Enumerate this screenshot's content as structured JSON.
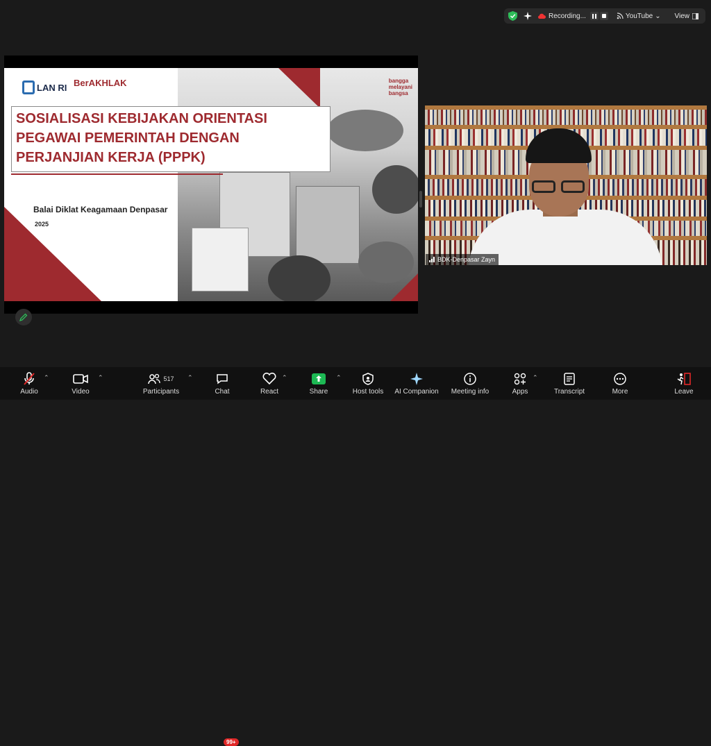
{
  "topbar": {
    "recording_label": "Recording...",
    "stream_label": "YouTube",
    "view_label": "View"
  },
  "slide": {
    "logo_lan": "LAN RI",
    "logo_berakhlak": "BerAKHLAK",
    "logo_bangga": [
      "bangga",
      "melayani",
      "bangsa"
    ],
    "title_lines": [
      "SOSIALISASI KEBIJAKAN ORIENTASI",
      "PEGAWAI PEMERINTAH DENGAN",
      "PERJANJIAN KERJA (PPPK)"
    ],
    "organizer": "Balai Diklat Keagamaan Denpasar",
    "year": "2025"
  },
  "video": {
    "participant_name": "BDK-Denpasar Zayn"
  },
  "toolbar": {
    "audio": "Audio",
    "video": "Video",
    "participants": "Participants",
    "participants_count": "517",
    "chat": "Chat",
    "chat_badge": "99+",
    "react": "React",
    "share": "Share",
    "host_tools": "Host tools",
    "ai_companion": "AI Companion",
    "meeting_info": "Meeting info",
    "apps": "Apps",
    "transcript": "Transcript",
    "more": "More",
    "leave": "Leave"
  },
  "colors": {
    "accent_red": "#9e2a2f",
    "share_green": "#1db954",
    "leave_red": "#e02828"
  }
}
